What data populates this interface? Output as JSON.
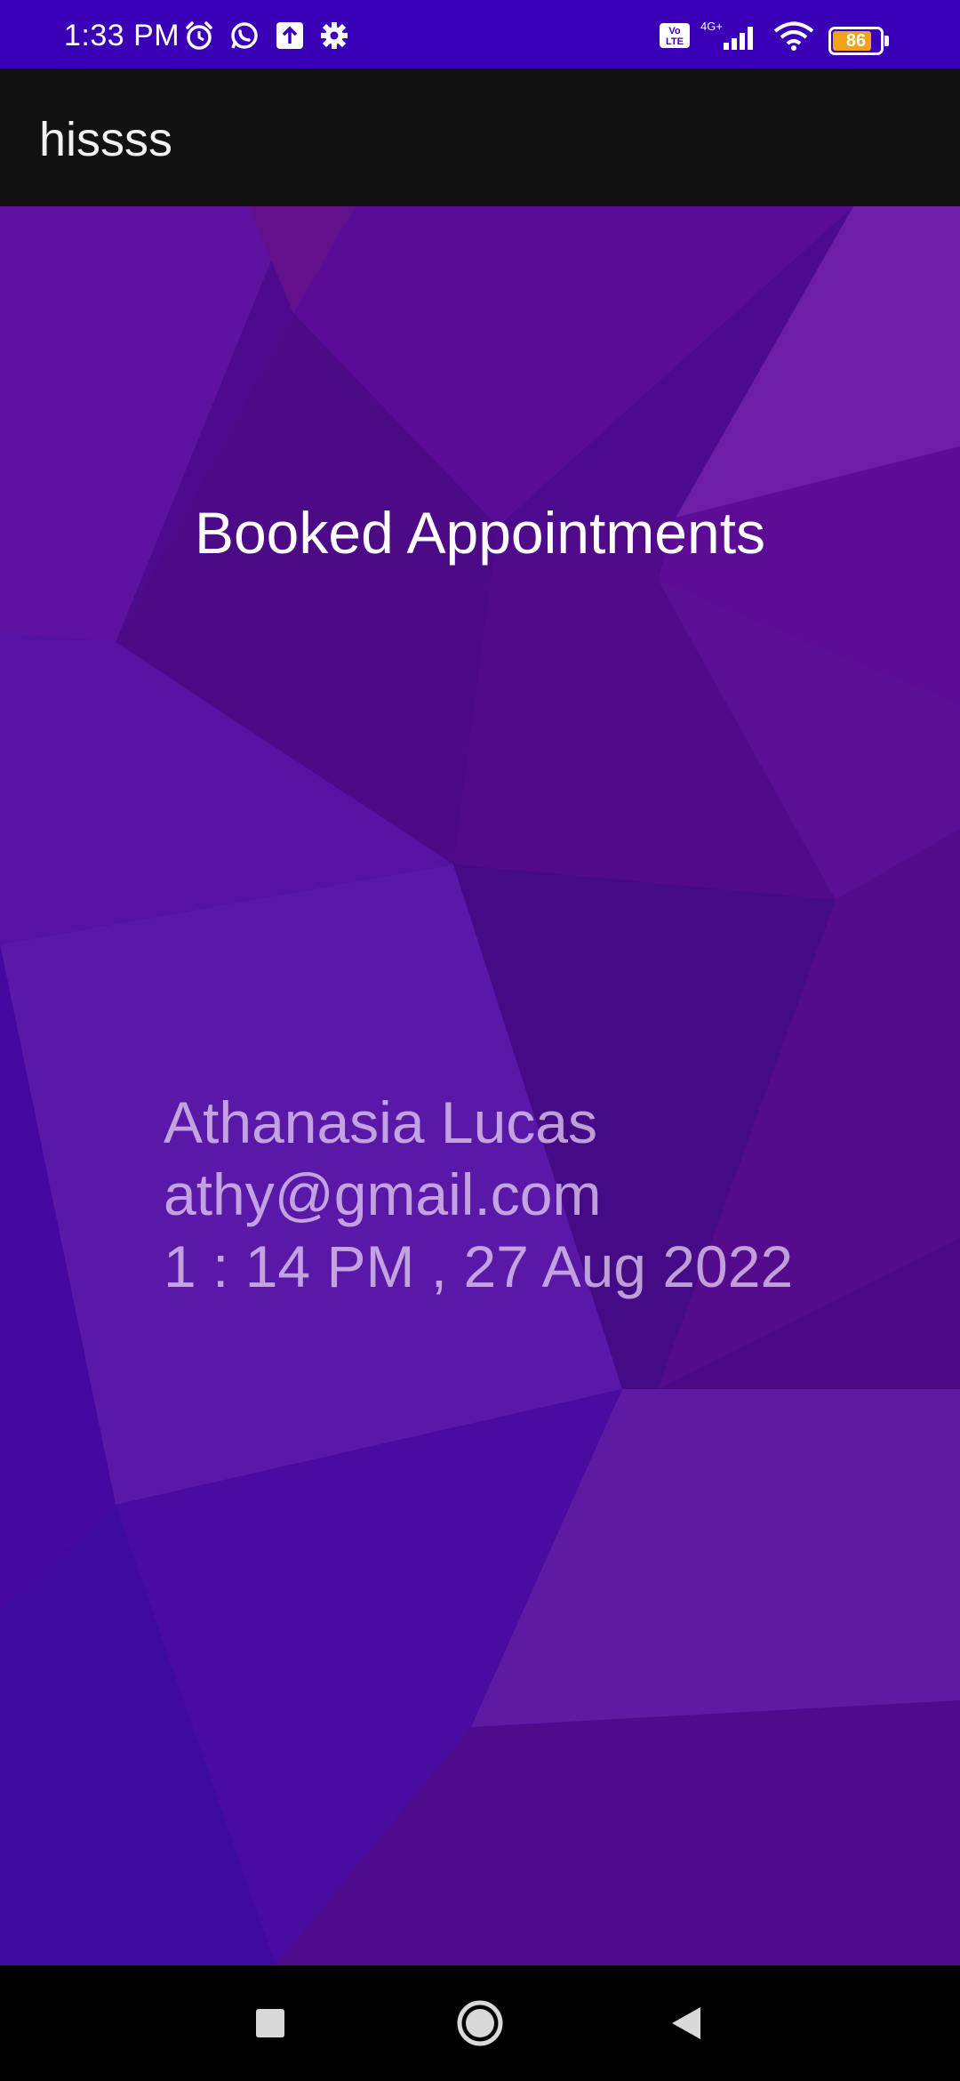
{
  "status_bar": {
    "time": "1:33 PM",
    "icons": [
      "alarm-icon",
      "whatsapp-icon",
      "upload-icon",
      "settings-icon",
      "volte-icon",
      "signal-icon",
      "wifi-icon",
      "battery-icon"
    ],
    "network_label": "4G+",
    "volte_label": "Vo LTE",
    "battery_level": "86",
    "background_color": "#3a00b8"
  },
  "app_bar": {
    "title": "hissss",
    "background_color": "#121212"
  },
  "main": {
    "heading": "Booked Appointments",
    "appointments": [
      {
        "name": "Athanasia Lucas",
        "email": "athy@gmail.com",
        "datetime": "1 : 14 PM , 27 Aug 2022"
      }
    ],
    "background_colors": [
      "#4a0a94",
      "#5e0fa0",
      "#6a1aa8",
      "#3f0aa0"
    ]
  },
  "nav_bar": {
    "buttons": [
      "recents-icon",
      "home-icon",
      "back-icon"
    ]
  }
}
